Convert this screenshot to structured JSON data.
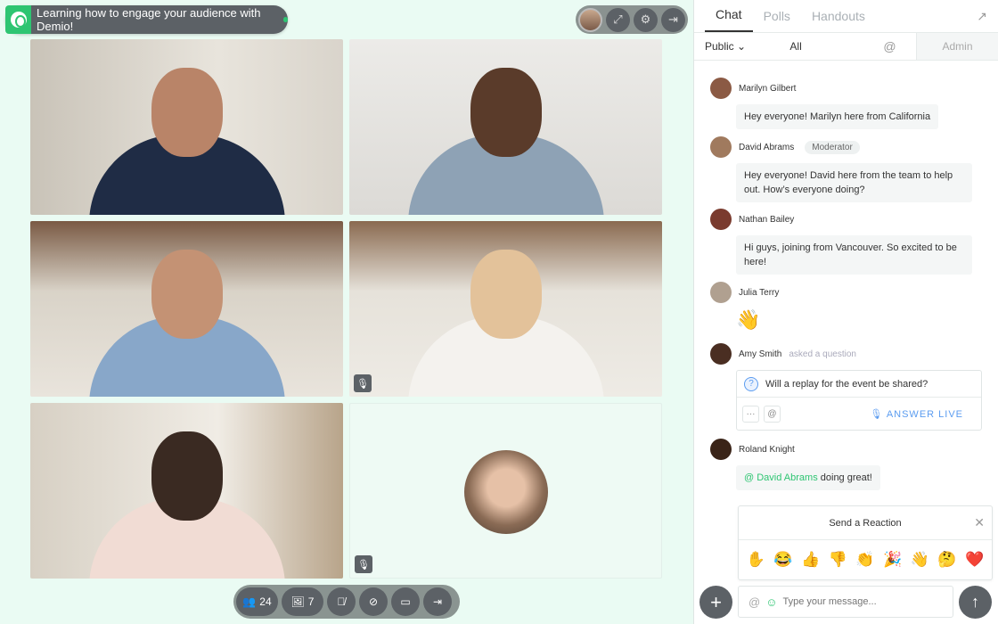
{
  "header": {
    "title": "Learning how to engage your audience with Demio!"
  },
  "top_tools": [
    "expand-icon",
    "gear-icon",
    "exit-icon"
  ],
  "controls": {
    "attendees_count": "24",
    "handouts_count": "7"
  },
  "sidebar": {
    "tabs": [
      {
        "label": "Chat"
      },
      {
        "label": "Polls"
      },
      {
        "label": "Handouts"
      }
    ],
    "filter": {
      "visibility": "Public",
      "audience": "All",
      "admin": "Admin"
    },
    "messages": [
      {
        "name": "Marilyn Gilbert",
        "text": "Hey everyone! Marilyn here from California"
      },
      {
        "name": "David Abrams",
        "badge": "Moderator",
        "text": "Hey everyone! David here from the team to help out. How’s everyone doing?"
      },
      {
        "name": "Nathan Bailey",
        "text": "Hi guys, joining from Vancouver. So excited to be here!"
      },
      {
        "name": "Julia Terry",
        "text": "👋"
      },
      {
        "name": "Amy Smith",
        "sub": "asked a question",
        "text": "Will a replay for the event be shared?",
        "action": "ANSWER LIVE"
      },
      {
        "name": "Roland Knight",
        "mention": "@ David Abrams",
        "text": " doing great!"
      }
    ],
    "reaction": {
      "title": "Send a Reaction",
      "emojis": [
        "✋",
        "😂",
        "👍",
        "👎",
        "👏",
        "🎉",
        "👋",
        "🤔",
        "❤️"
      ]
    },
    "input": {
      "placeholder": "Type your message..."
    }
  },
  "colors": {
    "accent": "#2ec572",
    "link": "#5b9cf0",
    "dark": "#5c6166"
  }
}
